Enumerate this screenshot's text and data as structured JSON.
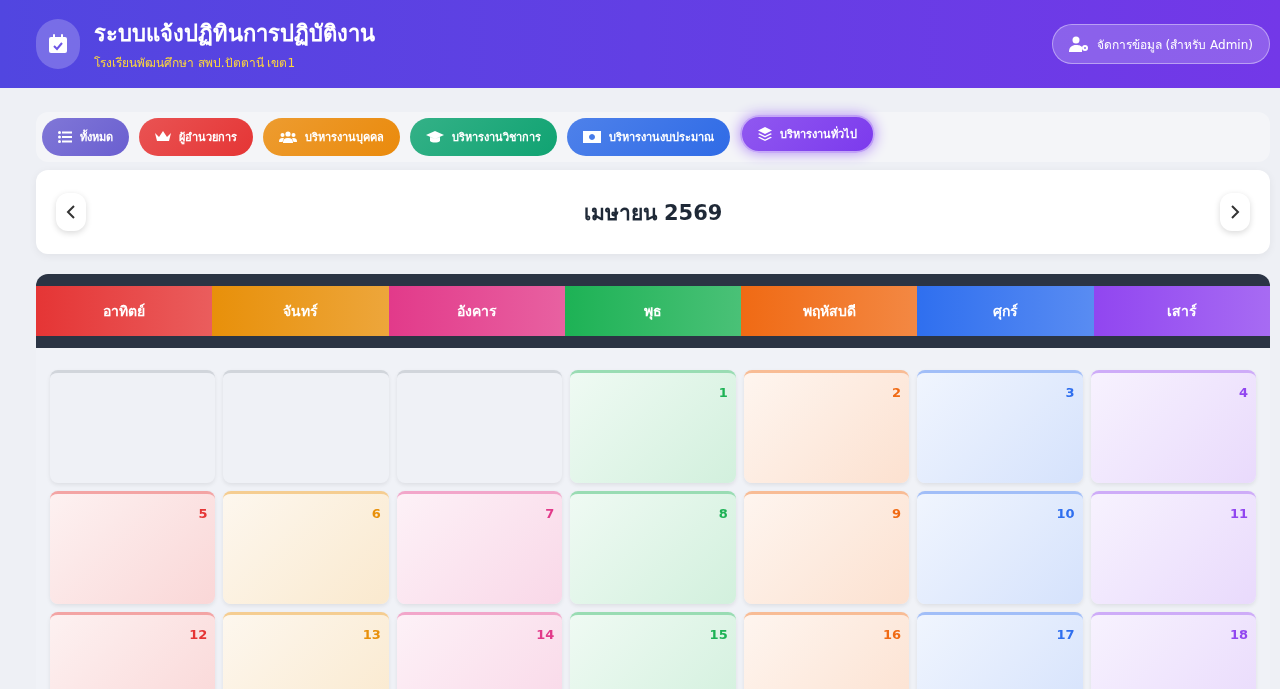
{
  "header": {
    "title": "ระบบแจ้งปฏิทินการปฏิบัติงาน",
    "subtitle": "โรงเรียนพัฒนศึกษา สพป.ปัตตานี เขต1",
    "admin_button": "จัดการข้อมูล (สำหรับ Admin)"
  },
  "filters": [
    {
      "label": "ทั้งหมด",
      "kind": "list",
      "color": "#6a5fd0",
      "selected": false
    },
    {
      "label": "ผู้อำนวยการ",
      "kind": "crown",
      "color": "#e53535",
      "selected": false
    },
    {
      "label": "บริหารงานบุคคล",
      "kind": "users",
      "color": "#ea8a0c",
      "selected": false
    },
    {
      "label": "บริหารงานวิชาการ",
      "kind": "cap",
      "color": "#10a372",
      "selected": false
    },
    {
      "label": "บริหารงานงบประมาณ",
      "kind": "money",
      "color": "#2f6be6",
      "selected": false
    },
    {
      "label": "บริหารงานทั่วไป",
      "kind": "layers",
      "color": "#7c3aed",
      "selected": true
    }
  ],
  "month_title": "เมษายน 2569",
  "weekdays": [
    {
      "label": "อาทิตย์",
      "color": "#e53535"
    },
    {
      "label": "จันทร์",
      "color": "#e8900a"
    },
    {
      "label": "อังคาร",
      "color": "#e23a8a"
    },
    {
      "label": "พุธ",
      "color": "#1db255"
    },
    {
      "label": "พฤหัสบดี",
      "color": "#f06a14"
    },
    {
      "label": "ศุกร์",
      "color": "#2f6fef"
    },
    {
      "label": "เสาร์",
      "color": "#9146f0"
    }
  ],
  "days": [
    {
      "kind": "empty"
    },
    {
      "kind": "empty"
    },
    {
      "kind": "empty"
    },
    {
      "kind": "day",
      "day": "1"
    },
    {
      "kind": "day",
      "day": "2"
    },
    {
      "kind": "day",
      "day": "3"
    },
    {
      "kind": "day",
      "day": "4"
    },
    {
      "kind": "day",
      "day": "5"
    },
    {
      "kind": "day",
      "day": "6"
    },
    {
      "kind": "day",
      "day": "7"
    },
    {
      "kind": "day",
      "day": "8"
    },
    {
      "kind": "day",
      "day": "9"
    },
    {
      "kind": "day",
      "day": "10"
    },
    {
      "kind": "day",
      "day": "11"
    },
    {
      "kind": "day",
      "day": "12"
    },
    {
      "kind": "day",
      "day": "13"
    },
    {
      "kind": "day",
      "day": "14"
    },
    {
      "kind": "day",
      "day": "15"
    },
    {
      "kind": "day",
      "day": "16"
    },
    {
      "kind": "day",
      "day": "17"
    },
    {
      "kind": "day",
      "day": "18"
    }
  ]
}
